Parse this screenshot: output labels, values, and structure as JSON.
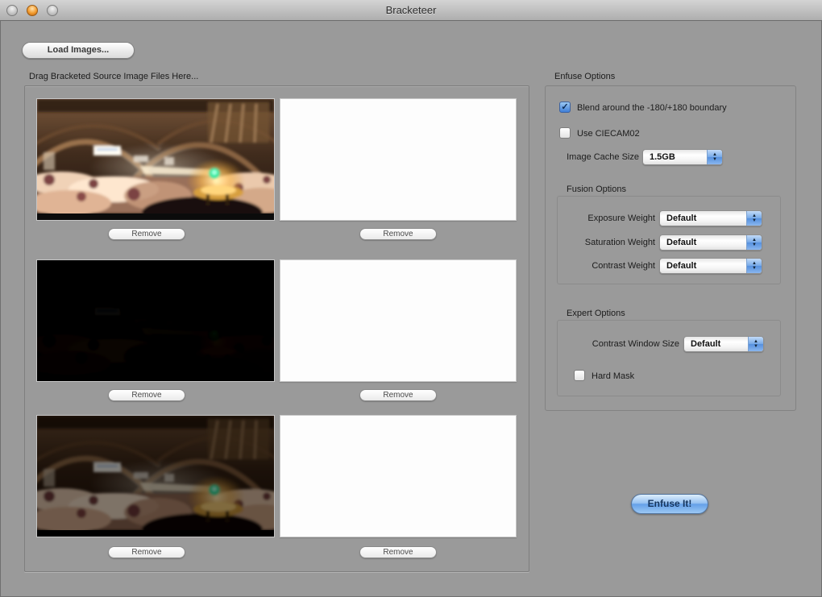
{
  "titlebar": {
    "title": "Bracketeer"
  },
  "toolbar": {
    "load_images_label": "Load Images..."
  },
  "source_panel": {
    "heading": "Drag Bracketed Source Image Files Here...",
    "remove_label": "Remove",
    "rows": [
      {
        "thumb": "bright-exposure-panorama"
      },
      {
        "thumb": "dark-exposure-panorama"
      },
      {
        "thumb": "mid-exposure-panorama"
      }
    ]
  },
  "options": {
    "title": "Enfuse Options",
    "blend_checkbox": {
      "label": "Blend around the -180/+180 boundary",
      "checked": true
    },
    "ciecam_checkbox": {
      "label": "Use CIECAM02",
      "checked": false
    },
    "image_cache": {
      "label": "Image Cache Size",
      "value": "1.5GB"
    },
    "fusion": {
      "title": "Fusion Options",
      "rows": [
        {
          "label": "Exposure Weight",
          "value": "Default"
        },
        {
          "label": "Saturation Weight",
          "value": "Default"
        },
        {
          "label": "Contrast Weight",
          "value": "Default"
        }
      ]
    },
    "expert": {
      "title": "Expert Options",
      "contrast_window": {
        "label": "Contrast Window Size",
        "value": "Default"
      },
      "hard_mask": {
        "label": "Hard Mask",
        "checked": false
      }
    },
    "enfuse_button_label": "Enfuse It!"
  },
  "icons": {
    "stepper_up": "▲",
    "stepper_down": "▼",
    "check": "✓"
  },
  "colors": {
    "window_background": "#9a9a9a",
    "titlebar_top": "#d4d4d4",
    "titlebar_bottom": "#aeaeae",
    "traffic_light_orange": "#f29b2e",
    "aqua_blue": "#5590df",
    "checkbox_checked_blue": "#3e7ed8",
    "enfuse_button_blue": "#64a0e8",
    "panel_border": "#7e7e7e",
    "empty_slot_white": "#fdfdfd"
  }
}
